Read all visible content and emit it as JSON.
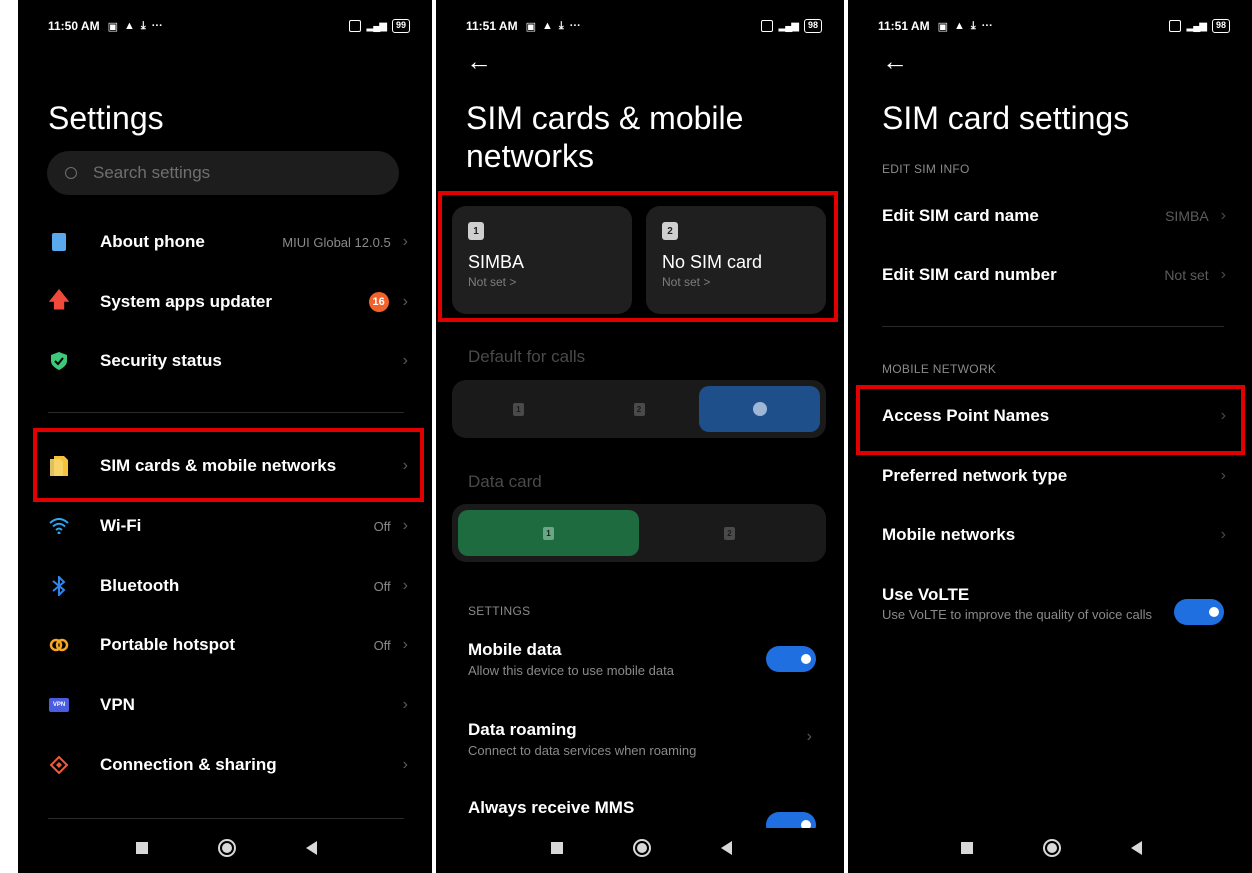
{
  "panel1": {
    "status": {
      "time": "11:50 AM",
      "battery": "99"
    },
    "title": "Settings",
    "search": {
      "placeholder": "Search settings"
    },
    "items": [
      {
        "label": "About phone",
        "value": "MIUI Global 12.0.5",
        "icon": "phone-icon",
        "color": "#5aa9ef"
      },
      {
        "label": "System apps updater",
        "badge": "16",
        "icon": "arrow-up-icon",
        "color": "#ef4a3a"
      },
      {
        "label": "Security status",
        "icon": "shield-check-icon",
        "color": "#3ec87a"
      },
      {
        "label": "SIM cards & mobile networks",
        "icon": "sim-card-icon",
        "color": "#f5c33b"
      },
      {
        "label": "Wi-Fi",
        "value": "Off",
        "icon": "wifi-icon",
        "color": "#2fa6f0"
      },
      {
        "label": "Bluetooth",
        "value": "Off",
        "icon": "bluetooth-icon",
        "color": "#2f86f0"
      },
      {
        "label": "Portable hotspot",
        "value": "Off",
        "icon": "hotspot-icon",
        "color": "#f5a623"
      },
      {
        "label": "VPN",
        "icon": "vpn-icon",
        "icon_text": "VPN",
        "color": "#4a5de0"
      },
      {
        "label": "Connection & sharing",
        "icon": "connection-sharing-icon",
        "color": "#ef5a3a"
      }
    ]
  },
  "panel2": {
    "status": {
      "time": "11:51 AM",
      "battery": "98"
    },
    "back": "←",
    "title_line1": "SIM cards & mobile",
    "title_line2": "networks",
    "sim1": {
      "num": "1",
      "name": "SIMBA",
      "sub": "Not set >"
    },
    "sim2": {
      "num": "2",
      "name": "No SIM card",
      "sub": "Not set >"
    },
    "default_calls_label": "Default for calls",
    "data_card_label": "Data card",
    "settings_header": "SETTINGS",
    "mobile_data": {
      "title": "Mobile data",
      "sub": "Allow this device to use mobile data"
    },
    "data_roaming": {
      "title": "Data roaming",
      "sub": "Connect to data services when roaming"
    },
    "mms": {
      "title": "Always receive MMS"
    },
    "chip1": "1",
    "chip2": "2"
  },
  "panel3": {
    "status": {
      "time": "11:51 AM",
      "battery": "98"
    },
    "back": "←",
    "title": "SIM card settings",
    "edit_header": "EDIT SIM INFO",
    "edit_name": {
      "label": "Edit SIM card name",
      "value": "SIMBA"
    },
    "edit_number": {
      "label": "Edit SIM card number",
      "value": "Not set"
    },
    "network_header": "MOBILE NETWORK",
    "apn": "Access Point Names",
    "preferred": "Preferred network type",
    "mobile_networks": "Mobile networks",
    "volte": {
      "title": "Use VoLTE",
      "sub": "Use VoLTE to improve the quality of voice calls"
    }
  },
  "accent": {
    "highlight": "#e00000",
    "toggle": "#1f6fe0",
    "data_selected": "#1d6b3f",
    "calls_selected": "#1f4f8a"
  }
}
